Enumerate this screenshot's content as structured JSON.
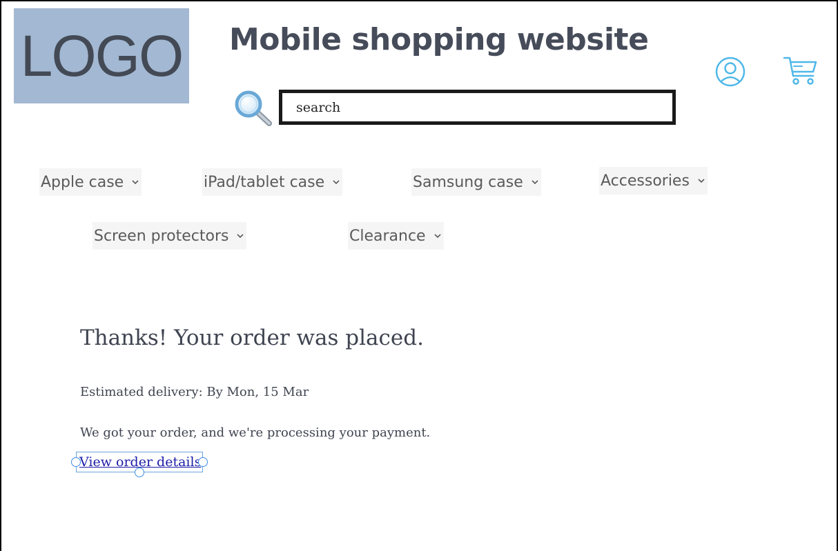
{
  "header": {
    "logo_text": "LOGO",
    "site_title": "Mobile shopping website",
    "search_placeholder": "search",
    "icons": [
      "search-icon",
      "account-icon",
      "cart-icon"
    ],
    "accent_color": "#4fb8e8"
  },
  "nav": {
    "items": [
      {
        "label": "Apple case"
      },
      {
        "label": "iPad/tablet case"
      },
      {
        "label": "Samsung case"
      },
      {
        "label": "Accessories"
      },
      {
        "label": "Screen protectors"
      },
      {
        "label": "Clearance"
      }
    ]
  },
  "confirmation": {
    "title": "Thanks! Your order was placed.",
    "delivery": "Estimated delivery:  By Mon, 15 Mar",
    "message": "We got your order, and we're processing your payment.",
    "link_label": "View order details"
  }
}
